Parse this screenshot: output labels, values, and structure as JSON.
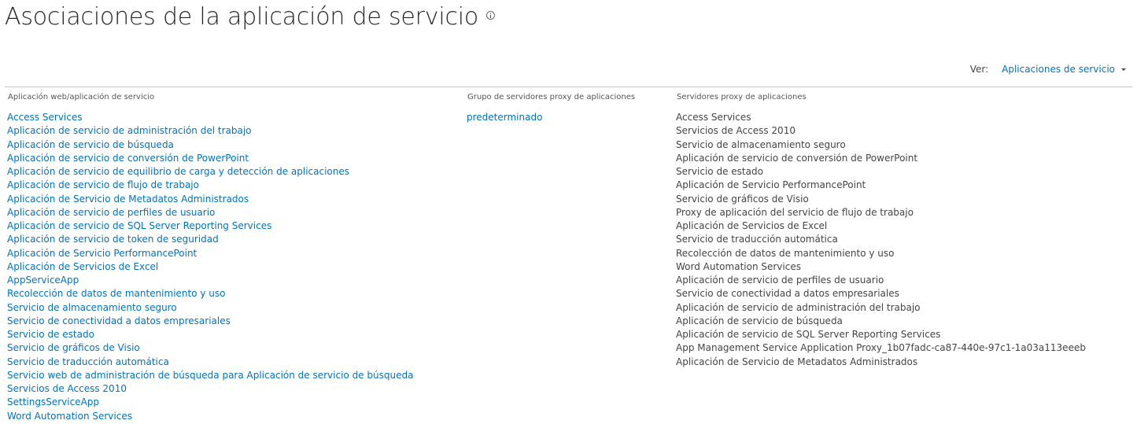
{
  "page": {
    "title": "Asociaciones de la aplicación de servicio",
    "info_icon": "info-icon"
  },
  "view": {
    "label": "Ver:",
    "selected": "Aplicaciones de servicio",
    "dropdown_icon": "chevron-down-icon"
  },
  "columns": {
    "web_app": "Aplicación web/aplicación de servicio",
    "proxy_group": "Grupo de servidores proxy de aplicaciones",
    "proxies": "Servidores proxy de aplicaciones"
  },
  "web_apps": [
    "Access Services",
    "Aplicación de servicio de administración del trabajo",
    "Aplicación de servicio de búsqueda",
    "Aplicación de servicio de conversión de PowerPoint",
    "Aplicación de servicio de equilibrio de carga y detección de aplicaciones",
    "Aplicación de servicio de flujo de trabajo",
    "Aplicación de Servicio de Metadatos Administrados",
    "Aplicación de servicio de perfiles de usuario",
    "Aplicación de servicio de SQL Server Reporting Services",
    "Aplicación de servicio de token de seguridad",
    "Aplicación de Servicio PerformancePoint",
    "Aplicación de Servicios de Excel",
    "AppServiceApp",
    "Recolección de datos de mantenimiento y uso",
    "Servicio de almacenamiento seguro",
    "Servicio de conectividad a datos empresariales",
    "Servicio de estado",
    "Servicio de gráficos de Visio",
    "Servicio de traducción automática",
    "Servicio web de administración de búsqueda para Aplicación de servicio de búsqueda",
    "Servicios de Access 2010",
    "SettingsServiceApp",
    "Word Automation Services"
  ],
  "proxy_groups": [
    "predeterminado"
  ],
  "proxies": [
    "Access Services",
    "Servicios de Access 2010",
    "Servicio de almacenamiento seguro",
    "Aplicación de servicio de conversión de PowerPoint",
    "Servicio de estado",
    "Aplicación de Servicio PerformancePoint",
    "Servicio de gráficos de Visio",
    "Proxy de aplicación del servicio de flujo de trabajo",
    "Aplicación de Servicios de Excel",
    "Servicio de traducción automática",
    "Recolección de datos de mantenimiento y uso",
    "Word Automation Services",
    "Aplicación de servicio de perfiles de usuario",
    "Servicio de conectividad a datos empresariales",
    "Aplicación de servicio de administración del trabajo",
    "Aplicación de servicio de búsqueda",
    "Aplicación de servicio de SQL Server Reporting Services",
    "App Management Service Application Proxy_1b07fadc-ca87-440e-97c1-1a03a113eeeb",
    "Aplicación de Servicio de Metadatos Administrados"
  ]
}
